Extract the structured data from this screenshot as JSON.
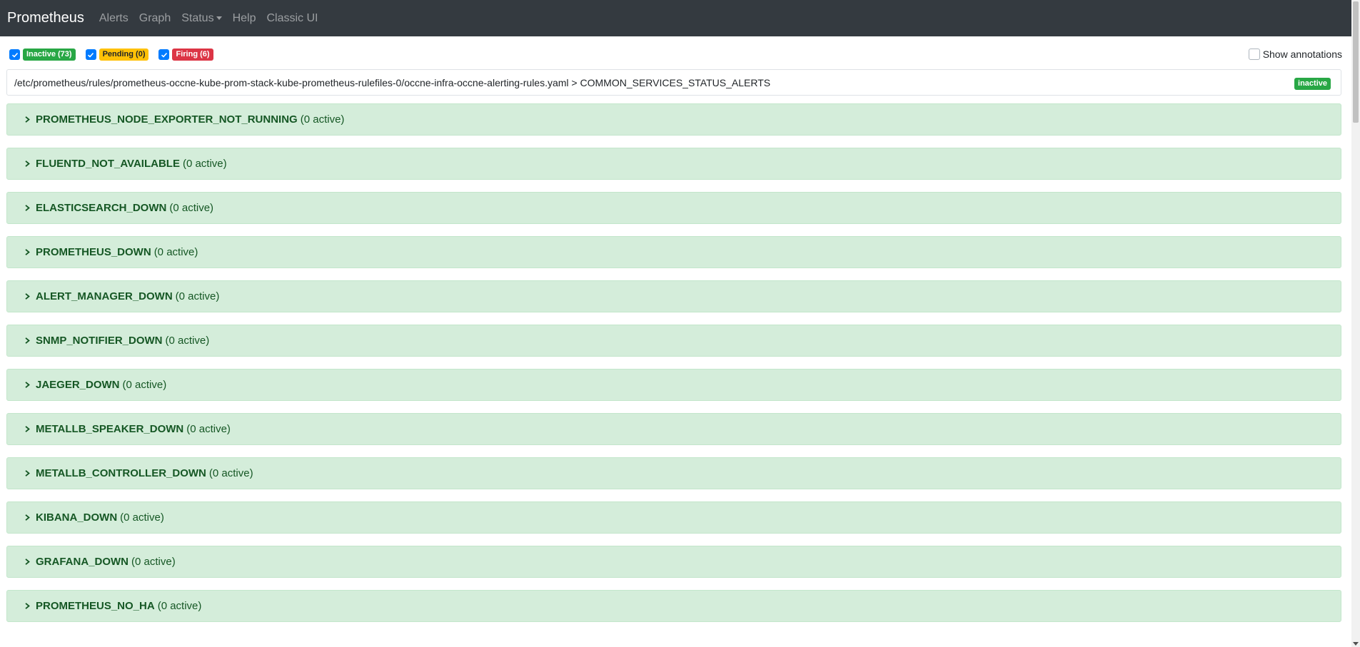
{
  "navbar": {
    "brand": "Prometheus",
    "links": [
      "Alerts",
      "Graph",
      "Status",
      "Help",
      "Classic UI"
    ]
  },
  "filters": {
    "inactive": "Inactive (73)",
    "pending": "Pending (0)",
    "firing": "Firing (6)",
    "show_annotations": "Show annotations"
  },
  "group": {
    "path": "/etc/prometheus/rules/prometheus-occne-kube-prom-stack-kube-prometheus-rulefiles-0/occne-infra-occne-alerting-rules.yaml > COMMON_SERVICES_STATUS_ALERTS",
    "state": "inactive"
  },
  "rules": [
    {
      "name": "PROMETHEUS_NODE_EXPORTER_NOT_RUNNING",
      "count": "(0 active)"
    },
    {
      "name": "FLUENTD_NOT_AVAILABLE",
      "count": "(0 active)"
    },
    {
      "name": "ELASTICSEARCH_DOWN",
      "count": "(0 active)"
    },
    {
      "name": "PROMETHEUS_DOWN",
      "count": "(0 active)"
    },
    {
      "name": "ALERT_MANAGER_DOWN",
      "count": "(0 active)"
    },
    {
      "name": "SNMP_NOTIFIER_DOWN",
      "count": "(0 active)"
    },
    {
      "name": "JAEGER_DOWN",
      "count": "(0 active)"
    },
    {
      "name": "METALLB_SPEAKER_DOWN",
      "count": "(0 active)"
    },
    {
      "name": "METALLB_CONTROLLER_DOWN",
      "count": "(0 active)"
    },
    {
      "name": "KIBANA_DOWN",
      "count": "(0 active)"
    },
    {
      "name": "GRAFANA_DOWN",
      "count": "(0 active)"
    },
    {
      "name": "PROMETHEUS_NO_HA",
      "count": "(0 active)"
    }
  ],
  "colors": {
    "navbar_bg": "#343a40",
    "rule_bg": "#d4edda",
    "rule_text": "#155724",
    "inactive": "#28a745",
    "pending": "#ffc107",
    "firing": "#dc3545",
    "checkbox": "#007bff"
  }
}
